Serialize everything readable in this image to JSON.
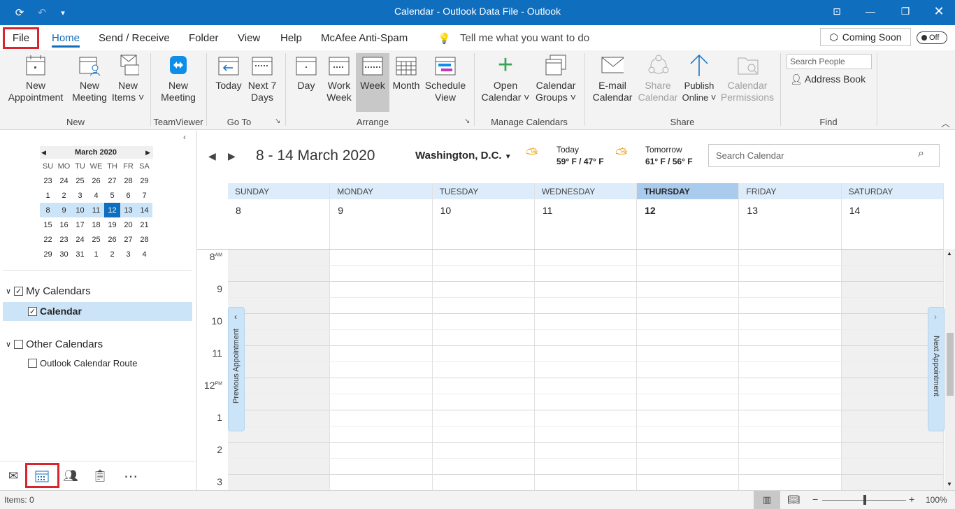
{
  "window": {
    "title": "Calendar - Outlook Data File - Outlook"
  },
  "menu": {
    "file": "File",
    "items": [
      "Home",
      "Send / Receive",
      "Folder",
      "View",
      "Help",
      "McAfee Anti-Spam"
    ],
    "tell_me": "Tell me what you want to do",
    "coming_soon": "Coming Soon",
    "toggle": "Off"
  },
  "ribbon": {
    "new_appt": [
      "New",
      "Appointment"
    ],
    "new_meeting": [
      "New",
      "Meeting"
    ],
    "new_items": [
      "New",
      "Items ˅"
    ],
    "tv_meeting": [
      "New",
      "Meeting"
    ],
    "today": "Today",
    "next7": [
      "Next 7",
      "Days"
    ],
    "day": "Day",
    "work_week": [
      "Work",
      "Week"
    ],
    "week": "Week",
    "month": "Month",
    "schedule": [
      "Schedule",
      "View"
    ],
    "open_cal": [
      "Open",
      "Calendar ˅"
    ],
    "cal_groups": [
      "Calendar",
      "Groups ˅"
    ],
    "email_cal": [
      "E-mail",
      "Calendar"
    ],
    "share_cal": [
      "Share",
      "Calendar"
    ],
    "publish": [
      "Publish",
      "Online ˅"
    ],
    "cal_perm": [
      "Calendar",
      "Permissions"
    ],
    "search_people": "Search People",
    "address_book": "Address Book",
    "groups": {
      "new": "New",
      "teamviewer": "TeamViewer",
      "goto": "Go To",
      "arrange": "Arrange",
      "manage": "Manage Calendars",
      "share": "Share",
      "find": "Find"
    }
  },
  "minical": {
    "month": "March 2020",
    "days": [
      "SU",
      "MO",
      "TU",
      "WE",
      "TH",
      "FR",
      "SA"
    ],
    "weeks": [
      [
        "23",
        "24",
        "25",
        "26",
        "27",
        "28",
        "29"
      ],
      [
        "1",
        "2",
        "3",
        "4",
        "5",
        "6",
        "7"
      ],
      [
        "8",
        "9",
        "10",
        "11",
        "12",
        "13",
        "14"
      ],
      [
        "15",
        "16",
        "17",
        "18",
        "19",
        "20",
        "21"
      ],
      [
        "22",
        "23",
        "24",
        "25",
        "26",
        "27",
        "28"
      ],
      [
        "29",
        "30",
        "31",
        "1",
        "2",
        "3",
        "4"
      ]
    ]
  },
  "tree": {
    "my": "My Calendars",
    "calendar": "Calendar",
    "other": "Other Calendars",
    "route": "Outlook Calendar Route"
  },
  "header": {
    "range": "8 - 14 March 2020",
    "location": "Washington,  D.C.",
    "today_label": "Today",
    "today_temp": "59° F / 47° F",
    "tomorrow_label": "Tomorrow",
    "tomorrow_temp": "61° F / 56° F",
    "search": "Search Calendar"
  },
  "days": [
    {
      "name": "SUNDAY",
      "num": "8"
    },
    {
      "name": "MONDAY",
      "num": "9"
    },
    {
      "name": "TUESDAY",
      "num": "10"
    },
    {
      "name": "WEDNESDAY",
      "num": "11"
    },
    {
      "name": "THURSDAY",
      "num": "12"
    },
    {
      "name": "FRIDAY",
      "num": "13"
    },
    {
      "name": "SATURDAY",
      "num": "14"
    }
  ],
  "hours": [
    {
      "h": "8",
      "s": "AM"
    },
    {
      "h": "9",
      "s": ""
    },
    {
      "h": "10",
      "s": ""
    },
    {
      "h": "11",
      "s": ""
    },
    {
      "h": "12",
      "s": "PM"
    },
    {
      "h": "1",
      "s": ""
    },
    {
      "h": "2",
      "s": ""
    },
    {
      "h": "3",
      "s": ""
    }
  ],
  "tabs": {
    "prev": "Previous Appointment",
    "next": "Next Appointment"
  },
  "status": {
    "items": "Items: 0",
    "zoom": "100%"
  }
}
